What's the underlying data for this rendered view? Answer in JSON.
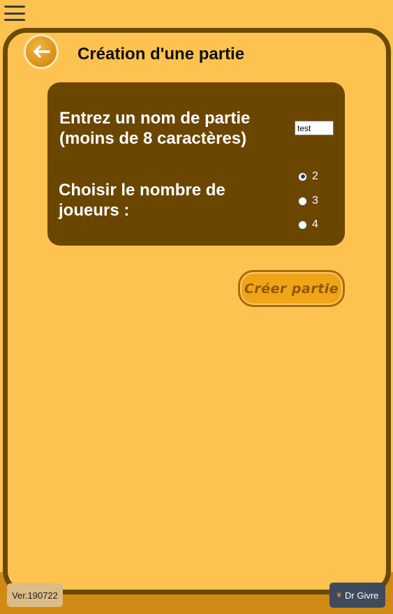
{
  "header": {
    "menu_icon": "hamburger-menu-icon",
    "back_icon": "arrow-left-icon",
    "title": "Création d'une partie"
  },
  "form": {
    "name_label_line1": "Entrez un nom de partie",
    "name_label_line2": "(moins de 8 caractères)",
    "name_value": "test",
    "players_label_line1": "Choisir le nombre de",
    "players_label_line2": "joueurs :",
    "player_options": [
      "2",
      "3",
      "4"
    ],
    "selected_players": "2"
  },
  "actions": {
    "create_label": "Créer partie"
  },
  "footer": {
    "version": "Ver.190722",
    "user_name": "Dr Givre",
    "user_icon": "leaf-icon"
  },
  "colors": {
    "background": "#fdc24f",
    "frame": "#6a4a02",
    "panel": "#6a4600",
    "button": "#f0a418"
  }
}
